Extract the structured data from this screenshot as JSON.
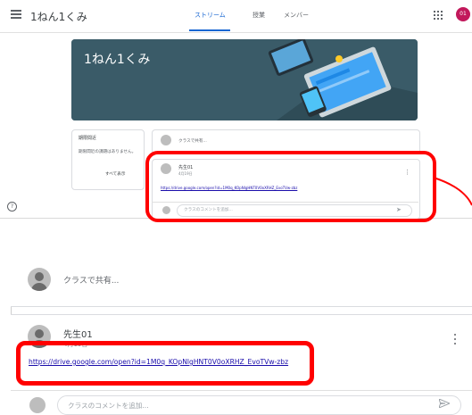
{
  "header": {
    "class_name": "1ねん1くみ",
    "tabs": [
      {
        "label": "ストリーム",
        "active": true
      },
      {
        "label": "授業"
      },
      {
        "label": "メンバー"
      }
    ],
    "account_initials": "01",
    "account_color": "#c2185b",
    "apps_icon": "apps-grid-icon",
    "menu_icon": "hamburger-menu-icon"
  },
  "banner": {
    "title": "1ねん1くみ",
    "color": "#3a5b68"
  },
  "upcoming": {
    "title": "期限間近",
    "text": "期限間近の課題はありません。",
    "view_all": "すべて表示"
  },
  "share": {
    "placeholder": "クラスで共有..."
  },
  "post": {
    "author": "先生01",
    "date": "4月19日",
    "link": "https://drive.google.com/open?id=1M0q_KOpNlgHNT0V0oXRHZ_EvoTVw-zbz"
  },
  "comment": {
    "placeholder": "クラスのコメントを追加..."
  },
  "help_icon": "help-icon",
  "highlight_color": "#ff0000"
}
